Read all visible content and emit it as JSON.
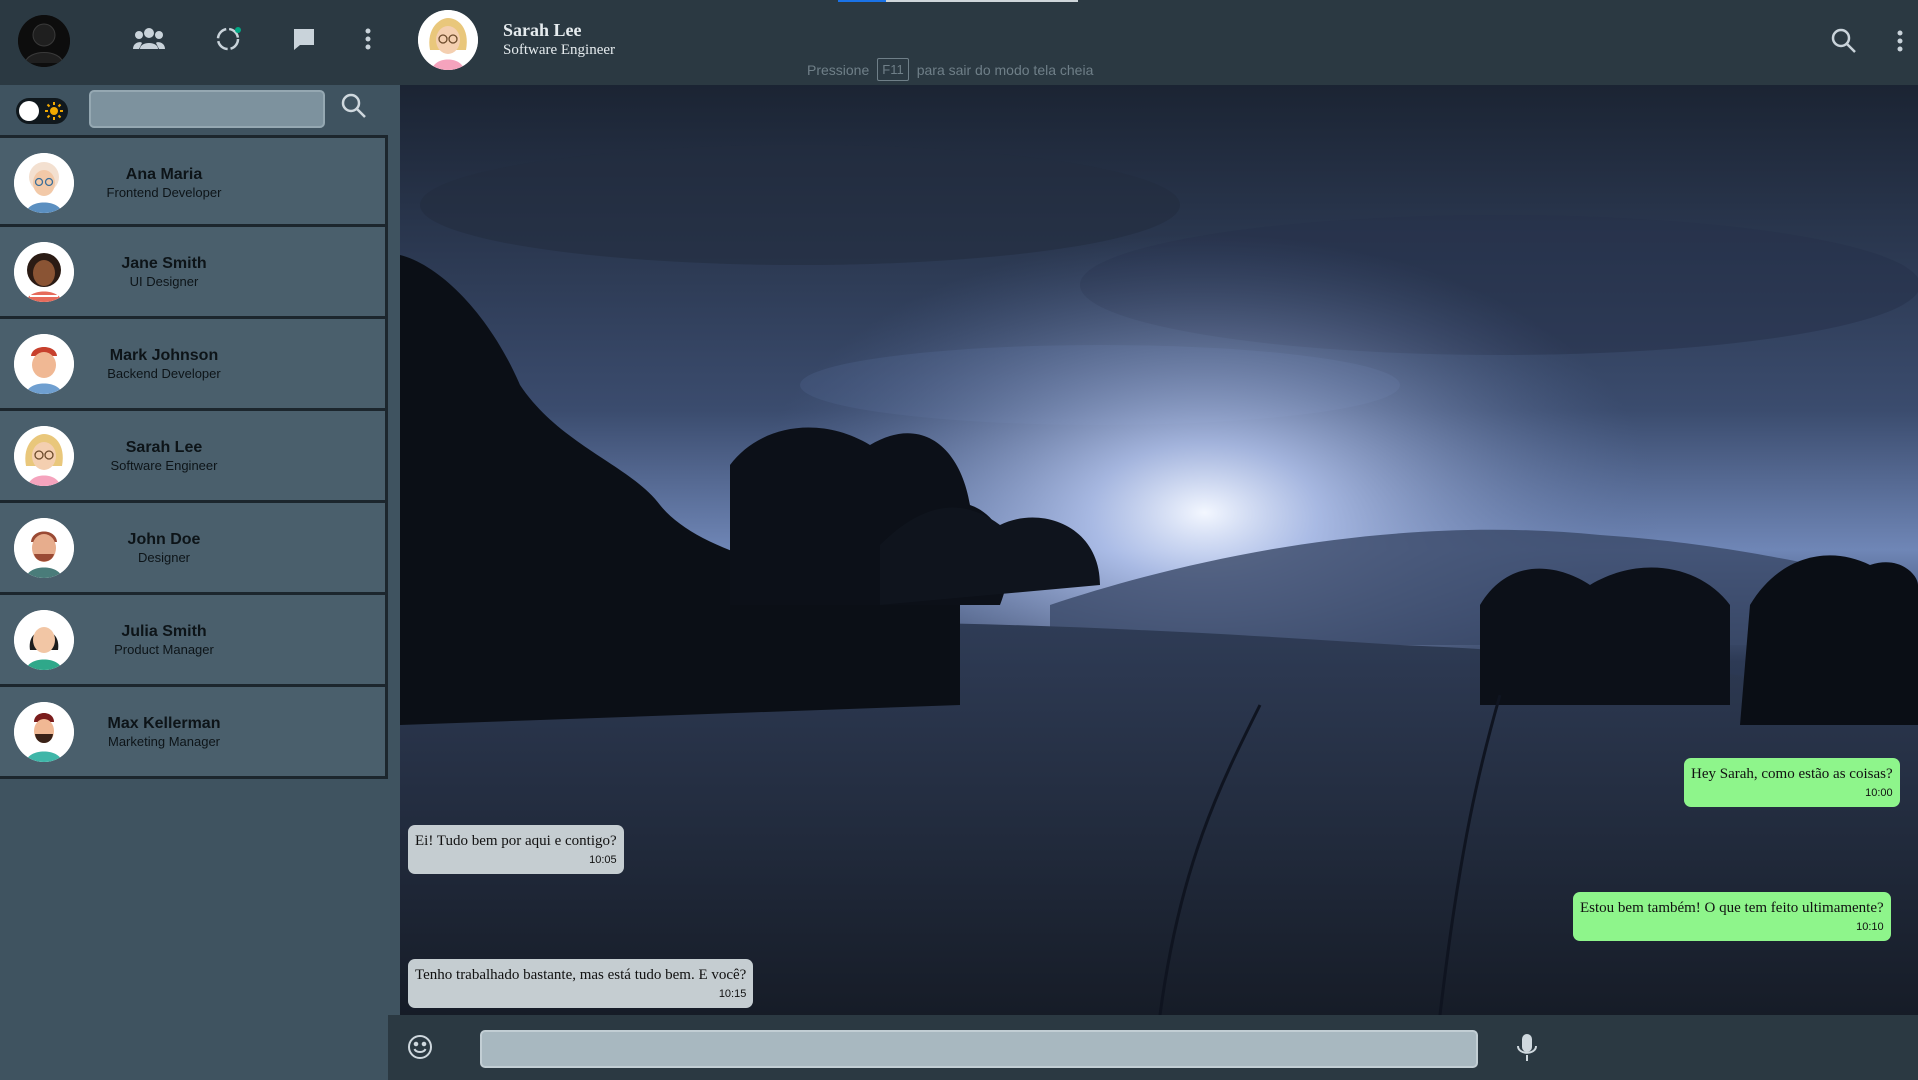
{
  "topbar": {
    "icons": [
      "profile-avatar",
      "community-icon",
      "status-icon",
      "chat-icon",
      "menu-dots-icon"
    ],
    "status_dot_color": "#00a884",
    "fullscreen_hint": {
      "before": "Pressione",
      "key": "F11",
      "after": "para sair do modo tela cheia"
    }
  },
  "chat_header": {
    "name": "Sarah Lee",
    "subtitle": "Software Engineer"
  },
  "sidebar": {
    "theme_toggle": "light-dark-toggle",
    "search_placeholder": "",
    "contacts": [
      {
        "name": "Ana Maria",
        "role": "Frontend Developer"
      },
      {
        "name": "Jane Smith",
        "role": "UI Designer"
      },
      {
        "name": "Mark Johnson",
        "role": "Backend Developer"
      },
      {
        "name": "Sarah Lee",
        "role": "Software Engineer"
      },
      {
        "name": "John Doe",
        "role": "Designer"
      },
      {
        "name": "Julia Smith",
        "role": "Product Manager"
      },
      {
        "name": "Max Kellerman",
        "role": "Marketing Manager"
      }
    ]
  },
  "messages": [
    {
      "dir": "out",
      "text": "Hey Sarah, como estão as coisas?",
      "time": "10:00"
    },
    {
      "dir": "in",
      "text": "Ei! Tudo bem por aqui e contigo?",
      "time": "10:05"
    },
    {
      "dir": "out",
      "text": "Estou bem também! O que tem feito ultimamente?",
      "time": "10:10"
    },
    {
      "dir": "in",
      "text": "Tenho trabalhado bastante, mas está tudo bem. E você?",
      "time": "10:15"
    }
  ],
  "composer": {
    "placeholder": ""
  },
  "colors": {
    "bar": "#2b3942",
    "sidebar": "#3f5360",
    "contact_row": "#4a5f6c",
    "incoming_bubble": "#c5cdd1",
    "outgoing_bubble": "#8ef58b"
  }
}
